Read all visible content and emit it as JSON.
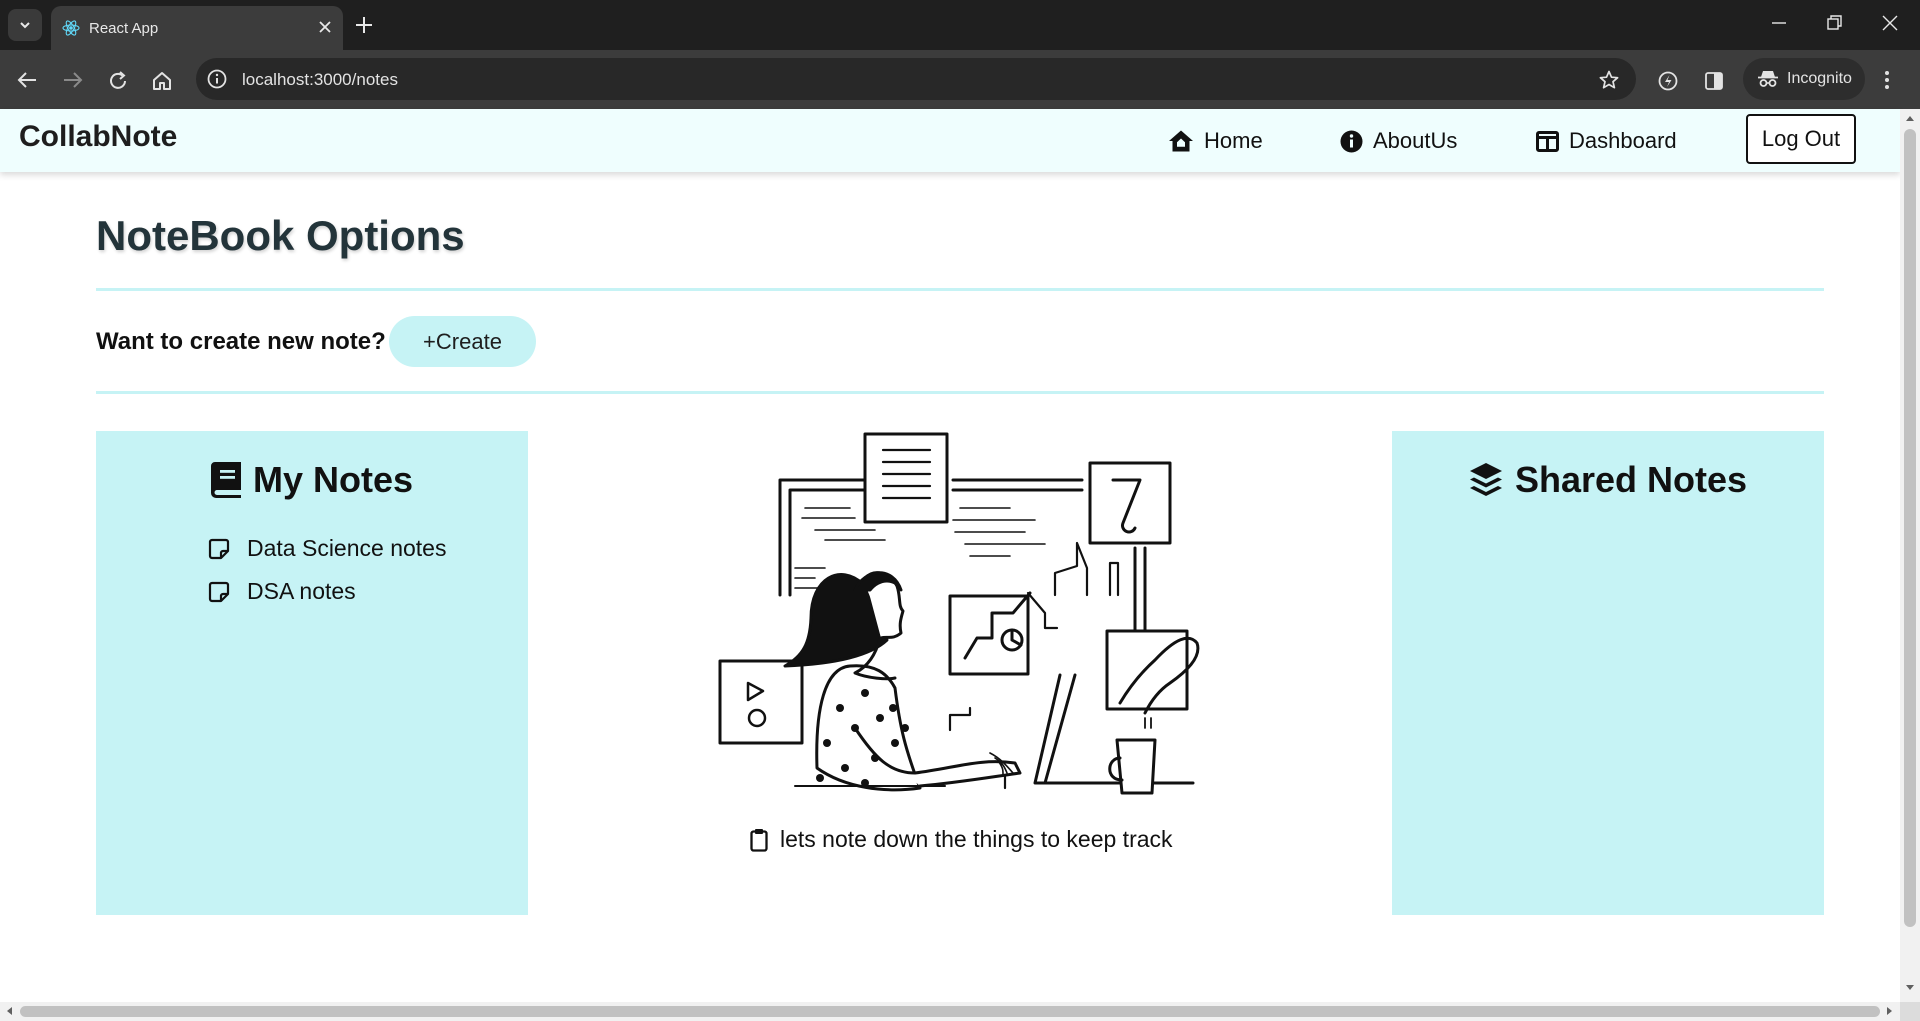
{
  "browser": {
    "tab_title": "React App",
    "url": "localhost:3000/notes",
    "incognito_label": "Incognito"
  },
  "navbar": {
    "brand": "CollabNote",
    "links": [
      {
        "label": "Home",
        "icon": "home-icon"
      },
      {
        "label": "AboutUs",
        "icon": "info-icon"
      },
      {
        "label": "Dashboard",
        "icon": "dashboard-icon"
      }
    ],
    "logout_label": "Log Out"
  },
  "page": {
    "title": "NoteBook Options",
    "create_prompt": "Want to create new note?",
    "create_label": "+Create"
  },
  "my_notes": {
    "title": "My Notes",
    "icon": "book-icon",
    "items": [
      {
        "label": "Data Science notes",
        "icon": "note-icon"
      },
      {
        "label": "DSA notes",
        "icon": "note-icon"
      }
    ]
  },
  "shared_notes": {
    "title": "Shared Notes",
    "icon": "layers-icon",
    "items": []
  },
  "illustration": {
    "caption": "lets note down the things to keep track",
    "caption_icon": "clipboard-icon"
  },
  "colors": {
    "panel_bg": "#c6f3f5",
    "navbar_bg": "#effefe",
    "title_text": "#23343a"
  }
}
